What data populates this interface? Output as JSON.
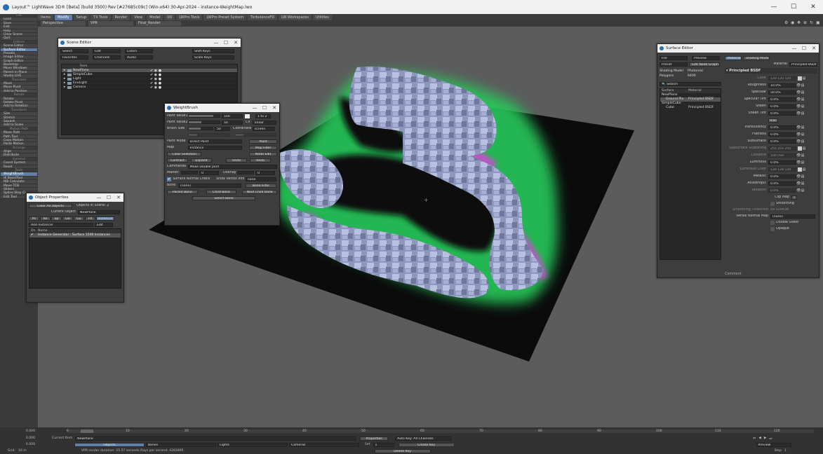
{
  "window": {
    "title": "Layout™ LightWave 3D® [Beta] (build 3500) Rev [#27685c09c] (Win-x64) 30-Apr-2024 - instance-WeightMap.lwo",
    "controls": [
      "—",
      "☐",
      "✕"
    ]
  },
  "menu_tabs": [
    "Items",
    "Modify",
    "Setup",
    "TX Tools",
    "Render",
    "View",
    "Model",
    "I/O",
    "LWPro Tools",
    "LWPro Preset System",
    "TurbulenceFD",
    "LW Workspaces",
    "Utilities"
  ],
  "active_menu": "Modify",
  "viewport_bar": {
    "view": "Perspective",
    "camera": "VPR",
    "render": "Final_Render"
  },
  "toolbox": [
    {
      "t": "File",
      "s": 1
    },
    {
      "t": "Load"
    },
    {
      "t": "Save"
    },
    {
      "t": "Edit"
    },
    {
      "t": "Help"
    },
    {
      "t": "Clear Scene"
    },
    {
      "t": "Quit"
    },
    {
      "t": "Editors",
      "s": 1
    },
    {
      "t": "Scene Editor"
    },
    {
      "t": "Surface Editor",
      "a": 1
    },
    {
      "t": "Presets"
    },
    {
      "t": "Image Editor"
    },
    {
      "t": "Graph Editor"
    },
    {
      "t": "Backdrop"
    },
    {
      "t": "Move Windows"
    },
    {
      "t": "Parent in Place"
    },
    {
      "t": "Studio LIVE"
    },
    {
      "t": "Translate",
      "s": 1
    },
    {
      "t": "Move"
    },
    {
      "t": "Move Pivot"
    },
    {
      "t": "Add to Position"
    },
    {
      "t": "Rotate",
      "s": 1
    },
    {
      "t": "Rotate"
    },
    {
      "t": "Rotate Pivot"
    },
    {
      "t": "Add to Rotation"
    },
    {
      "t": "Transform",
      "s": 1
    },
    {
      "t": "Size"
    },
    {
      "t": "Stretch"
    },
    {
      "t": "Squash"
    },
    {
      "t": "Add to Scale"
    },
    {
      "t": "Motion Path",
      "s": 1
    },
    {
      "t": "Move Path"
    },
    {
      "t": "Path Tool"
    },
    {
      "t": "Copy Motion"
    },
    {
      "t": "Paste Motion"
    },
    {
      "t": "Arrange",
      "s": 1
    },
    {
      "t": "Align"
    },
    {
      "t": "Distribute"
    },
    {
      "t": "General",
      "s": 1
    },
    {
      "t": "Coord System"
    },
    {
      "t": "Reset"
    },
    {
      "t": "Tools",
      "s": 1
    },
    {
      "t": "WeightBrush",
      "a": 1
    },
    {
      "t": "IK BoostTool"
    },
    {
      "t": "IKB Calculate"
    },
    {
      "t": "Move TCB"
    },
    {
      "t": "Sliders"
    },
    {
      "t": "Spline Step Cl"
    },
    {
      "t": "Edit Tool"
    }
  ],
  "scene_editor": {
    "title": "Scene Editor",
    "row1": [
      "Select",
      "Edit",
      "Colors",
      "Shift Keys"
    ],
    "row2": [
      "Favorites",
      "Channels",
      "Audio",
      "Scale Keys"
    ],
    "col_item": "Item",
    "items": [
      "NewPlane",
      "SimpleCube",
      "Light",
      "EnvLight",
      "Camera"
    ]
  },
  "weightbrush": {
    "title": "WeightBrush",
    "paint_value1": "Paint Value1",
    "pv1": "100",
    "range": "1 to 2",
    "paint_value2": "Paint Value2",
    "pv2": "50",
    "cv": "CV",
    "cv_val": "linear",
    "brush_size": "Brush Size",
    "bs": "50",
    "coordinate": "Coordinate",
    "coord_val": "screen",
    "paint_mode": "Paint Mode",
    "pm": "Direct Paint",
    "paint": "Paint",
    "map": "Map",
    "map_val": "Instance",
    "map_filter": "Map Filter",
    "clear_selection": "Clear Selection",
    "node_edit": "Node Edit",
    "contract": "Contract",
    "expand": "Expand",
    "undo": "Undo",
    "redo": "Redo",
    "commands": "Commands",
    "cmd_val": "Make Double Joint",
    "marker": "Marker",
    "marker_val": "0",
    "overlay": "Overlay",
    "overlay_val": "0",
    "surface_normal": "Surface Normal Check",
    "show_vertex": "Show Vertex Info",
    "sv_val": "none",
    "bone": "Bone",
    "bone_val": "(none)",
    "bone_filter": "Bone Filter",
    "parent_bone": "Parent Bone",
    "child_bone": "Child Bone",
    "next_child": "Next Child Bone",
    "select_bone": "Select Bone"
  },
  "object_props": {
    "title": "Object Properties",
    "clear_all": "Clear All Objects",
    "objects_in_scene": "Objects in Scene: 2",
    "current_object_lbl": "Current Object",
    "current_object": "NewPlane",
    "tabs": [
      "Pri",
      "Re",
      "Sp",
      "Ge",
      "Gu",
      "FX",
      "Instancer"
    ],
    "add_instancer": "Add Instancer",
    "edit": "Edit",
    "col_on": "On",
    "col_name": "Name",
    "instance_row": "Instance Generator : Surface 1500 Instances"
  },
  "surface_editor": {
    "title": "Surface Editor",
    "top": [
      "File",
      "Preview",
      "Material",
      "Shading Model"
    ],
    "preset": "Preset",
    "edit_node": "Edit Node Graph",
    "material_lbl": "Material",
    "material": "Principled BSDF",
    "shading_model_lbl": "Shading Model",
    "shading_model": "Photoreal",
    "polygons_lbl": "Polygons",
    "polygons": "6400",
    "search": "Search",
    "col_surface": "Surface",
    "col_material": "Material",
    "tree": [
      {
        "s": "NewPlane",
        "m": ""
      },
      {
        "s": "Ground Pla",
        "m": "Principled BSDF"
      },
      {
        "s": "SimpleCube",
        "m": ""
      },
      {
        "s": "Cube",
        "m": "Principled BSDF"
      }
    ],
    "section": "Principled BSDF",
    "props": [
      {
        "n": "Color",
        "v": "120 120 120",
        "c": 1
      },
      {
        "n": "Roughness",
        "v": "10.0%"
      },
      {
        "n": "Specular",
        "v": "50.0%"
      },
      {
        "n": "Specular Tint",
        "v": "0.0%"
      },
      {
        "n": "Sheen",
        "v": "0.0%"
      },
      {
        "n": "Sheen Tint",
        "v": "0.0%"
      },
      {
        "n": "",
        "v": "Bias",
        "b": 1
      },
      {
        "n": "Translucency",
        "v": "0.0%"
      },
      {
        "n": "Flatness",
        "v": "0.0%"
      },
      {
        "n": "Subsurface",
        "v": "0.0%"
      },
      {
        "n": "Subsurface Scattering",
        "v": "255 255 255",
        "c": 1
      },
      {
        "n": "Distance",
        "v": "100 mm"
      },
      {
        "n": "Luminous",
        "v": "0.0%"
      },
      {
        "n": "Luminous Color",
        "v": "128 128 128",
        "c": 1
      },
      {
        "n": "Metallic",
        "v": "0.0%"
      },
      {
        "n": "Anisotropic",
        "v": "0.0%"
      },
      {
        "n": "Rotation",
        "v": "0.0%"
      }
    ],
    "clip_map": "Clip Map",
    "clip_t": "T",
    "smoothing": "Smoothing",
    "smoothing_thr": "Smoothing Threshold",
    "smoothing_val": "89.528438",
    "vertex_normal": "Vertex Normal Map",
    "vn_val": "(none)",
    "double_sided": "Double Sided",
    "opaque": "Opaque",
    "comment": "Comment"
  },
  "timeline": {
    "ticks": [
      "0",
      "10",
      "20",
      "30",
      "40",
      "50",
      "60",
      "70",
      "80",
      "90",
      "100",
      "110",
      "120"
    ],
    "current_item_lbl": "Current Item",
    "current_item": "NewPlane",
    "properties": "Properties",
    "autokey": "Auto Key: All Channels",
    "tabs": [
      "Objects",
      "Bones",
      "Lights",
      "Cameras"
    ],
    "set": "Set",
    "set_val": "1",
    "create_key": "Create Key",
    "delete_key": "Delete Key",
    "vpr_status": "VPR render duration: 25.57 seconds  Rays per second: 4281895",
    "preview": "Preview",
    "step": "Step",
    "step_val": "1",
    "left_vals": [
      "0.000",
      "0.000",
      "0.000"
    ],
    "grid": "Grid:",
    "grid_val": "10 m"
  },
  "colors": {
    "accent": "#5f7fa8",
    "ground": "#0a0a0a",
    "glow": "#29e060",
    "magenta": "#e040e0",
    "cube": "#aab4d8"
  }
}
